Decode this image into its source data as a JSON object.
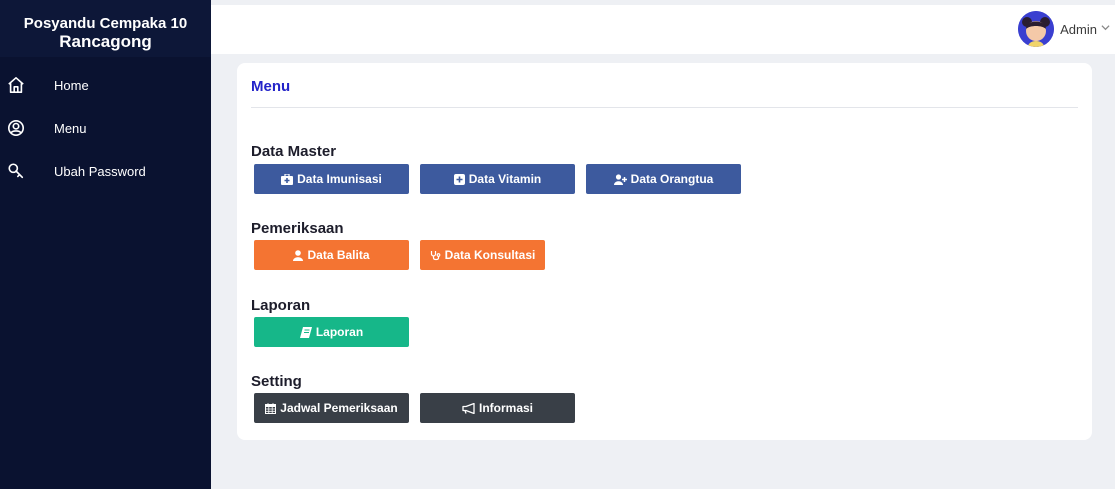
{
  "brand": {
    "line1": "Posyandu Cempaka 10",
    "line2": "Rancagong"
  },
  "sidebar": {
    "items": [
      {
        "label": "Home",
        "icon": "home-icon"
      },
      {
        "label": "Menu",
        "icon": "user-circle-icon"
      },
      {
        "label": "Ubah Password",
        "icon": "key-icon"
      }
    ]
  },
  "topbar": {
    "user_name": "Admin",
    "avatar_icon": "avatar-icon",
    "dropdown_icon": "chevron-down-icon"
  },
  "card": {
    "title": "Menu",
    "sections": [
      {
        "title": "Data Master",
        "buttons": [
          {
            "label": "Data Imunisasi",
            "icon": "medkit-icon",
            "color": "#3d5a9e"
          },
          {
            "label": "Data Vitamin",
            "icon": "plus-square-icon",
            "color": "#3d5a9e"
          },
          {
            "label": "Data Orangtua",
            "icon": "user-plus-icon",
            "color": "#3d5a9e"
          }
        ]
      },
      {
        "title": "Pemeriksaan",
        "buttons": [
          {
            "label": "Data Balita",
            "icon": "user-icon",
            "color": "#f47432"
          },
          {
            "label": "Data Konsultasi",
            "icon": "stethoscope-icon",
            "color": "#f47432"
          }
        ]
      },
      {
        "title": "Laporan",
        "buttons": [
          {
            "label": "Laporan",
            "icon": "book-icon",
            "color": "#16b789"
          }
        ]
      },
      {
        "title": "Setting",
        "buttons": [
          {
            "label": "Jadwal Pemeriksaan",
            "icon": "calendar-icon",
            "color": "#393f47"
          },
          {
            "label": "Informasi",
            "icon": "bullhorn-icon",
            "color": "#393f47"
          }
        ]
      }
    ]
  }
}
